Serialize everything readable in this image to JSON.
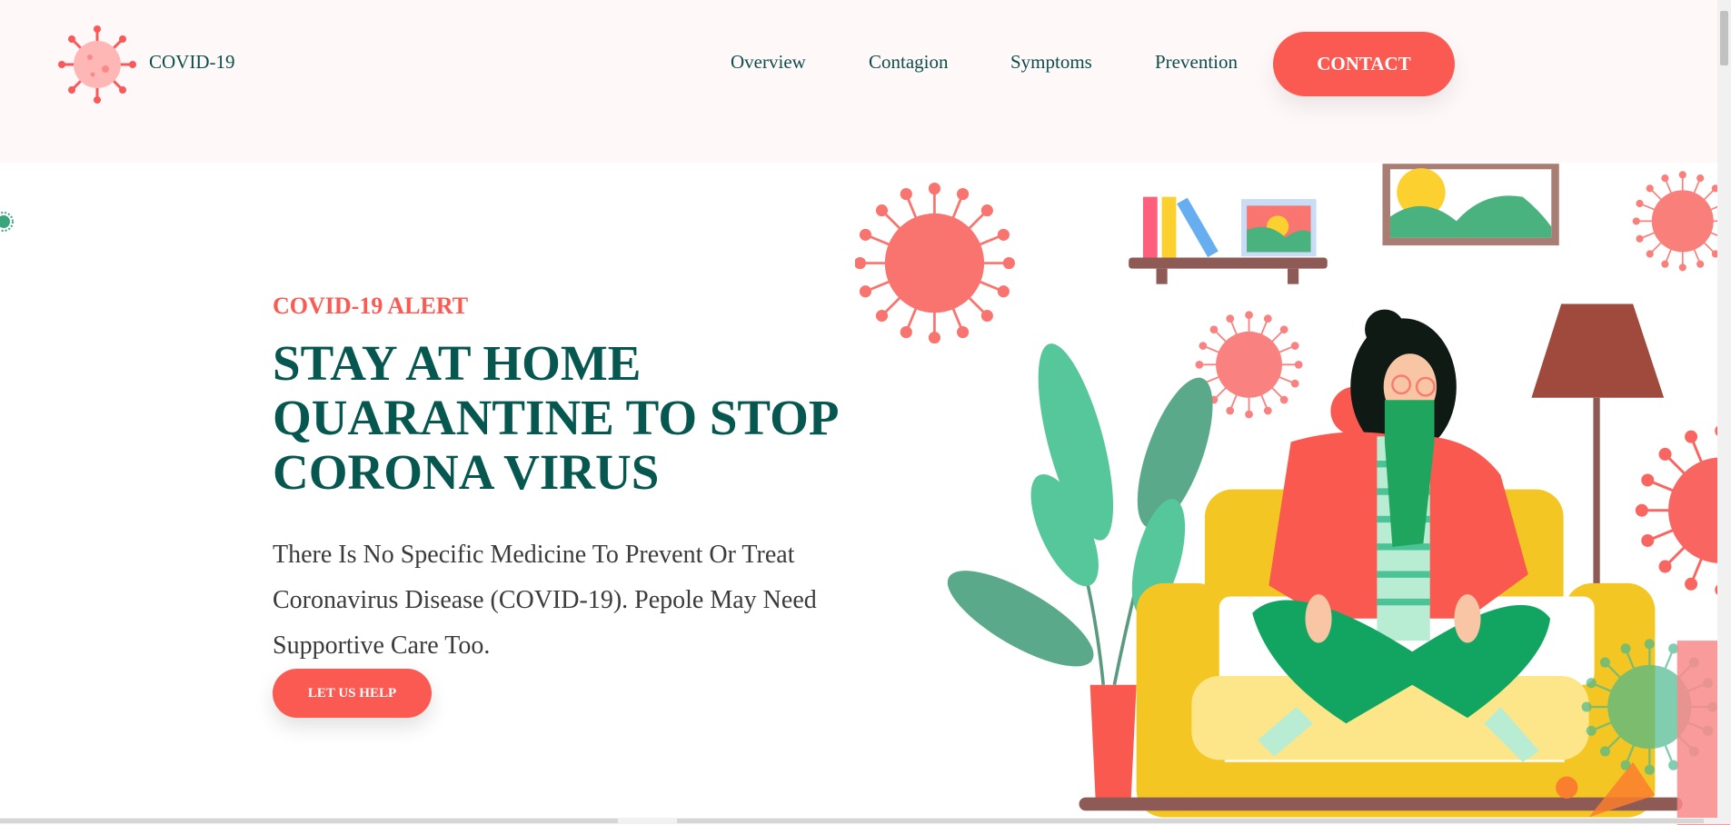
{
  "header": {
    "brand": "COVID-19",
    "nav": [
      "Overview",
      "Contagion",
      "Symptoms",
      "Prevention"
    ],
    "contact_label": "CONTACT"
  },
  "hero": {
    "alert": "COVID-19 ALERT",
    "title_lines": [
      "STAY AT HOME",
      "QUARANTINE TO STOP",
      "CORONA VIRUS"
    ],
    "paragraph": "There Is No Specific Medicine To Prevent Or Treat Coronavirus Disease (COVID-19). Pepole May Need Supportive Care Too.",
    "button_label": "LET US HELP"
  },
  "colors": {
    "accent": "#fa5a52",
    "heading": "#06574f",
    "header_bg": "#fff8f8"
  },
  "icons": {
    "logo": "virus-icon",
    "illustration": "woman-quarantine-illustration"
  }
}
